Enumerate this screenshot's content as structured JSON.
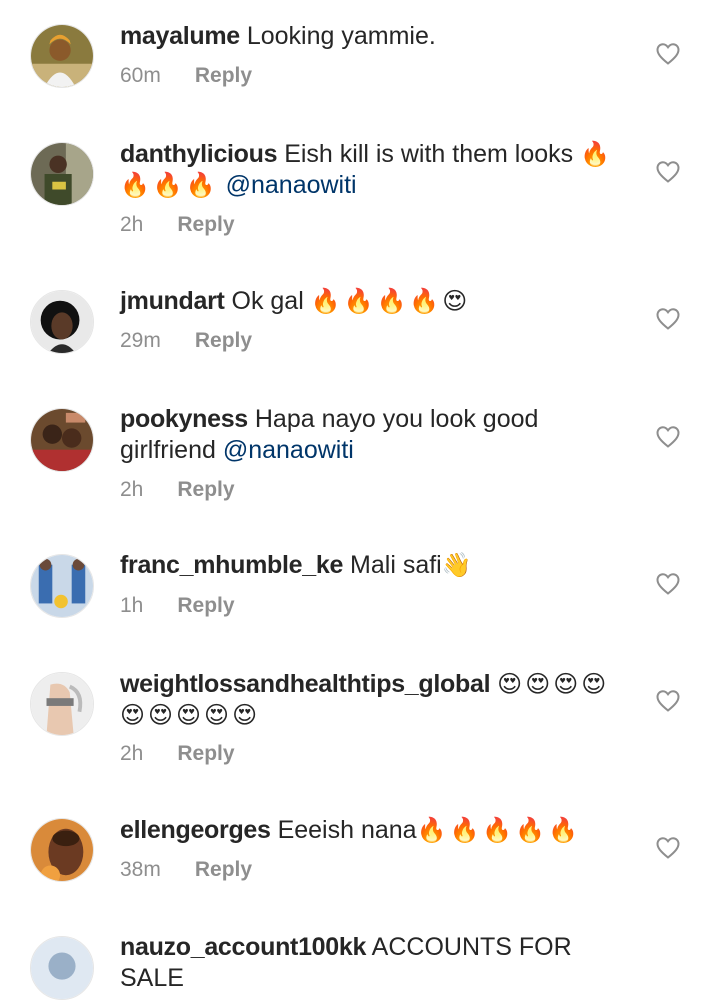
{
  "comments": [
    {
      "username": "mayalume",
      "text": "Looking yammie.",
      "mention": "",
      "emojis": "",
      "emojis2": "",
      "time": "60m",
      "reply": "Reply"
    },
    {
      "username": "danthylicious",
      "text": "Eish kill is with them looks",
      "mention": "@nanaowiti",
      "emojis": "🔥",
      "emojis2": "🔥🔥🔥",
      "time": "2h",
      "reply": "Reply"
    },
    {
      "username": "jmundart",
      "text": "Ok gal",
      "mention": "",
      "emojis": "🔥🔥🔥🔥😍",
      "emojis2": "",
      "time": "29m",
      "reply": "Reply"
    },
    {
      "username": "pookyness",
      "text": "Hapa nayo you look good girlfriend",
      "mention": "@nanaowiti",
      "emojis": "",
      "emojis2": "",
      "time": "2h",
      "reply": "Reply"
    },
    {
      "username": "franc_mhumble_ke",
      "text": "Mali safi",
      "mention": "",
      "emojis": "👋",
      "emojis2": "",
      "time": "1h",
      "reply": "Reply"
    },
    {
      "username": "weightlossandhealthtips_global",
      "text": "",
      "mention": "",
      "emojis": "😍😍😍😍",
      "emojis2": "😍😍😍😍😍",
      "time": "2h",
      "reply": "Reply"
    },
    {
      "username": "ellengeorges",
      "text": "Eeeish nana",
      "mention": "",
      "emojis": "🔥🔥🔥🔥🔥",
      "emojis2": "",
      "time": "38m",
      "reply": "Reply"
    },
    {
      "username": "nauzo_account100kk",
      "text": "ACCOUNTS FOR SALE",
      "mention": "",
      "emojis": "",
      "emojis2": "",
      "time": "",
      "reply": ""
    }
  ],
  "icons": {
    "like": "heart-outline-icon"
  },
  "colors": {
    "username": "#262626",
    "text": "#262626",
    "meta": "#8e8e8e",
    "mention": "#003569",
    "heart_stroke": "#8e8e8e"
  }
}
